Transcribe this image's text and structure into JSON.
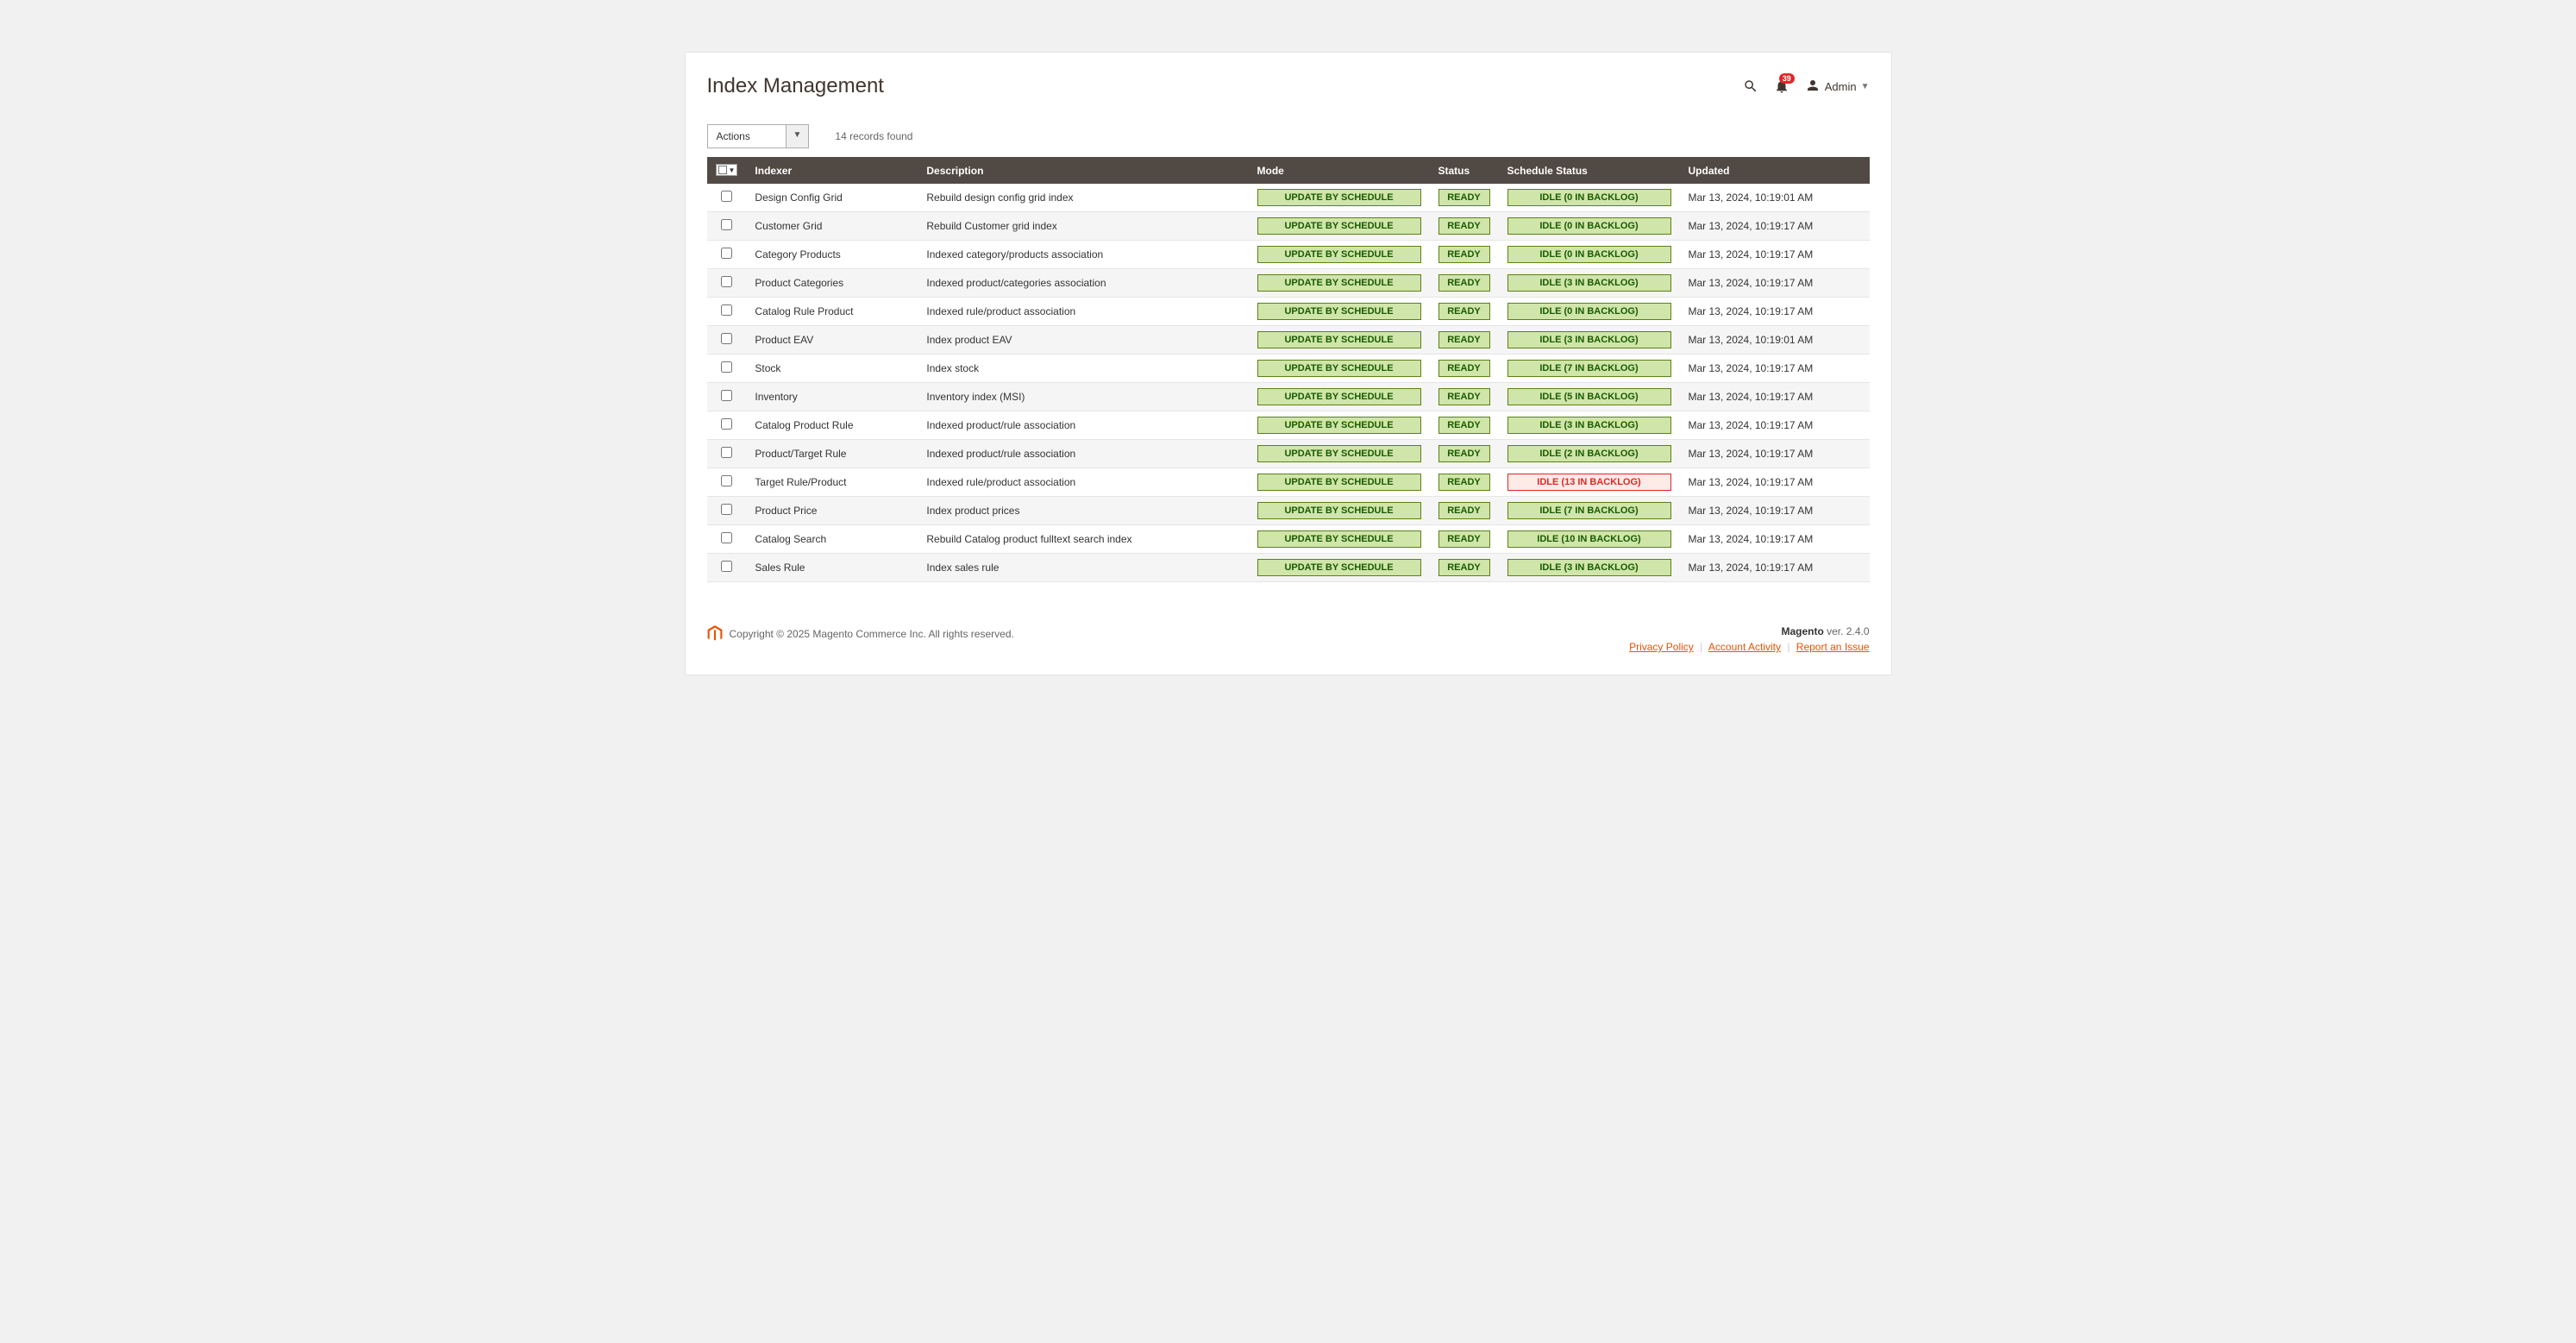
{
  "page": {
    "title": "Index Management"
  },
  "header": {
    "notification_count": "39",
    "user_label": "Admin"
  },
  "toolbar": {
    "actions_label": "Actions",
    "records_found": "14 records found"
  },
  "columns": {
    "indexer": "Indexer",
    "description": "Description",
    "mode": "Mode",
    "status": "Status",
    "schedule_status": "Schedule Status",
    "updated": "Updated"
  },
  "rows": [
    {
      "indexer": "Design Config Grid",
      "description": "Rebuild design config grid index",
      "mode": "UPDATE BY SCHEDULE",
      "status": "READY",
      "schedule": "IDLE (0 IN BACKLOG)",
      "schedule_warn": false,
      "updated": "Mar 13, 2024, 10:19:01 AM"
    },
    {
      "indexer": "Customer Grid",
      "description": "Rebuild Customer grid index",
      "mode": "UPDATE BY SCHEDULE",
      "status": "READY",
      "schedule": "IDLE (0 IN BACKLOG)",
      "schedule_warn": false,
      "updated": "Mar 13, 2024, 10:19:17 AM"
    },
    {
      "indexer": "Category Products",
      "description": "Indexed category/products association",
      "mode": "UPDATE BY SCHEDULE",
      "status": "READY",
      "schedule": "IDLE (0 IN BACKLOG)",
      "schedule_warn": false,
      "updated": "Mar 13, 2024, 10:19:17 AM"
    },
    {
      "indexer": "Product Categories",
      "description": "Indexed product/categories association",
      "mode": "UPDATE BY SCHEDULE",
      "status": "READY",
      "schedule": "IDLE (3 IN BACKLOG)",
      "schedule_warn": false,
      "updated": "Mar 13, 2024, 10:19:17 AM"
    },
    {
      "indexer": "Catalog Rule Product",
      "description": "Indexed rule/product association",
      "mode": "UPDATE BY SCHEDULE",
      "status": "READY",
      "schedule": "IDLE (0 IN BACKLOG)",
      "schedule_warn": false,
      "updated": "Mar 13, 2024, 10:19:17 AM"
    },
    {
      "indexer": "Product EAV",
      "description": "Index product EAV",
      "mode": "UPDATE BY SCHEDULE",
      "status": "READY",
      "schedule": "IDLE (3 IN BACKLOG)",
      "schedule_warn": false,
      "updated": "Mar 13, 2024, 10:19:01 AM"
    },
    {
      "indexer": "Stock",
      "description": "Index stock",
      "mode": "UPDATE BY SCHEDULE",
      "status": "READY",
      "schedule": "IDLE (7 IN BACKLOG)",
      "schedule_warn": false,
      "updated": "Mar 13, 2024, 10:19:17 AM"
    },
    {
      "indexer": "Inventory",
      "description": "Inventory index (MSI)",
      "mode": "UPDATE BY SCHEDULE",
      "status": "READY",
      "schedule": "IDLE (5 IN BACKLOG)",
      "schedule_warn": false,
      "updated": "Mar 13, 2024, 10:19:17 AM"
    },
    {
      "indexer": "Catalog Product Rule",
      "description": "Indexed product/rule association",
      "mode": "UPDATE BY SCHEDULE",
      "status": "READY",
      "schedule": "IDLE (3 IN BACKLOG)",
      "schedule_warn": false,
      "updated": "Mar 13, 2024, 10:19:17 AM"
    },
    {
      "indexer": "Product/Target Rule",
      "description": "Indexed product/rule association",
      "mode": "UPDATE BY SCHEDULE",
      "status": "READY",
      "schedule": "IDLE (2 IN BACKLOG)",
      "schedule_warn": false,
      "updated": "Mar 13, 2024, 10:19:17 AM"
    },
    {
      "indexer": "Target Rule/Product",
      "description": "Indexed rule/product association",
      "mode": "UPDATE BY SCHEDULE",
      "status": "READY",
      "schedule": "IDLE (13 IN BACKLOG)",
      "schedule_warn": true,
      "updated": "Mar 13, 2024, 10:19:17 AM"
    },
    {
      "indexer": "Product Price",
      "description": "Index product prices",
      "mode": "UPDATE BY SCHEDULE",
      "status": "READY",
      "schedule": "IDLE (7 IN BACKLOG)",
      "schedule_warn": false,
      "updated": "Mar 13, 2024, 10:19:17 AM"
    },
    {
      "indexer": "Catalog Search",
      "description": "Rebuild Catalog product fulltext search index",
      "mode": "UPDATE BY SCHEDULE",
      "status": "READY",
      "schedule": "IDLE (10 IN BACKLOG)",
      "schedule_warn": false,
      "updated": "Mar 13, 2024, 10:19:17 AM"
    },
    {
      "indexer": "Sales Rule",
      "description": "Index sales rule",
      "mode": "UPDATE BY SCHEDULE",
      "status": "READY",
      "schedule": "IDLE (3 IN BACKLOG)",
      "schedule_warn": false,
      "updated": "Mar 13, 2024, 10:19:17 AM"
    }
  ],
  "footer": {
    "copyright": "Copyright © 2025 Magento Commerce Inc. All rights reserved.",
    "version_label": "Magento",
    "version_value": " ver. 2.4.0",
    "privacy": "Privacy Policy",
    "account_activity": "Account Activity",
    "report_issue": "Report an Issue"
  }
}
